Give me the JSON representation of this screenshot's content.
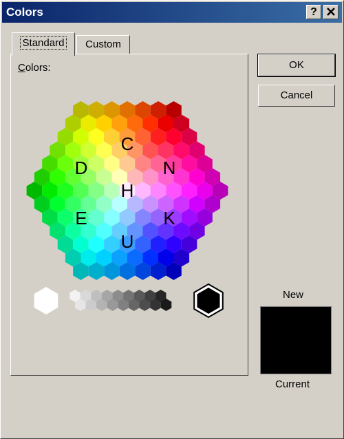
{
  "title": "Colors",
  "titlebar_buttons": {
    "help": "?",
    "close": "X"
  },
  "tabs": [
    {
      "label": "Standard",
      "active": true
    },
    {
      "label": "Custom",
      "active": false
    }
  ],
  "panel": {
    "colors_label_prefix": "C",
    "colors_label_rest": "olors:"
  },
  "hexagon_letters": [
    "C",
    "D",
    "N",
    "H",
    "E",
    "K",
    "U"
  ],
  "buttons": {
    "ok": "OK",
    "cancel": "Cancel"
  },
  "preview": {
    "new_label": "New",
    "current_label": "Current",
    "current_color": "#000000"
  },
  "grayscale": [
    "#ffffff",
    "#f2f2f2",
    "#e6e6e6",
    "#d9d9d9",
    "#cccccc",
    "#bfbfbf",
    "#b3b3b3",
    "#a6a6a6",
    "#999999",
    "#8c8c8c",
    "#808080",
    "#737373",
    "#666666",
    "#595959",
    "#4d4d4d",
    "#404040",
    "#333333",
    "#262626",
    "#1a1a1a",
    "#000000"
  ],
  "colors": {
    "title_bg_left": "#0a246a",
    "face": "#d4d0c8",
    "selected": "#000000"
  }
}
